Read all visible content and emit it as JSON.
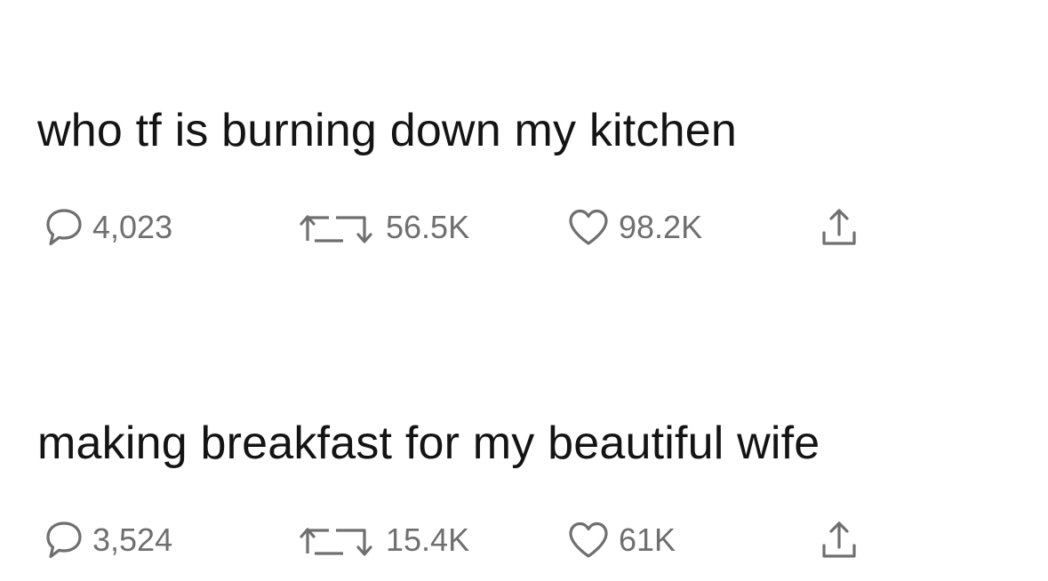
{
  "tweets": [
    {
      "text": "who tf is burning down my kitchen",
      "replies": "4,023",
      "retweets": "56.5K",
      "likes": "98.2K"
    },
    {
      "text": "making breakfast for my beautiful wife",
      "replies": "3,524",
      "retweets": "15.4K",
      "likes": "61K"
    }
  ],
  "icons": {
    "reply": "speech-bubble-icon",
    "retweet": "retweet-arrows-icon",
    "like": "heart-outline-icon",
    "share": "share-upload-icon"
  },
  "colors": {
    "text": "#141414",
    "icon_gray": "#6f6f6f",
    "background": "#ffffff"
  }
}
